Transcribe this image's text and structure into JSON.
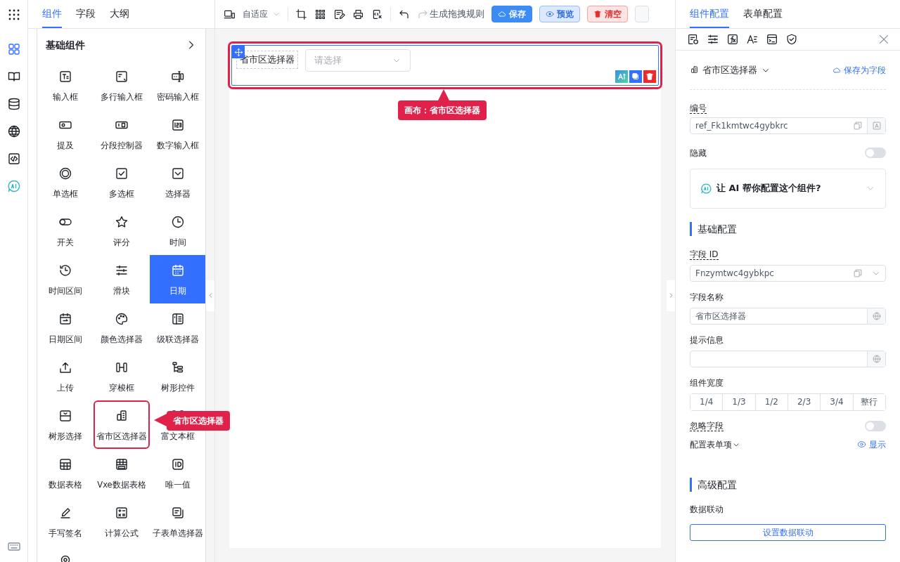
{
  "rail_items": [
    {
      "selected": true
    },
    {
      "selected": false
    },
    {
      "selected": false
    },
    {
      "selected": false
    },
    {
      "selected": false
    },
    {
      "selected": false
    }
  ],
  "left_tabs": [
    {
      "label": "组件",
      "selected": true
    },
    {
      "label": "字段",
      "selected": false
    },
    {
      "label": "大纲",
      "selected": false
    }
  ],
  "palette": {
    "title": "基础组件",
    "items": [
      {
        "label": "输入框",
        "selected": false,
        "annotated": false
      },
      {
        "label": "多行输入框",
        "selected": false,
        "annotated": false
      },
      {
        "label": "密码输入框",
        "selected": false,
        "annotated": false
      },
      {
        "label": "提及",
        "selected": false,
        "annotated": false
      },
      {
        "label": "分段控制器",
        "selected": false,
        "annotated": false
      },
      {
        "label": "数字输入框",
        "selected": false,
        "annotated": false
      },
      {
        "label": "单选框",
        "selected": false,
        "annotated": false
      },
      {
        "label": "多选框",
        "selected": false,
        "annotated": false
      },
      {
        "label": "选择器",
        "selected": false,
        "annotated": false
      },
      {
        "label": "开关",
        "selected": false,
        "annotated": false
      },
      {
        "label": "评分",
        "selected": false,
        "annotated": false
      },
      {
        "label": "时间",
        "selected": false,
        "annotated": false
      },
      {
        "label": "时间区间",
        "selected": false,
        "annotated": false
      },
      {
        "label": "滑块",
        "selected": false,
        "annotated": false
      },
      {
        "label": "日期",
        "selected": true,
        "annotated": false
      },
      {
        "label": "日期区间",
        "selected": false,
        "annotated": false
      },
      {
        "label": "颜色选择器",
        "selected": false,
        "annotated": false
      },
      {
        "label": "级联选择器",
        "selected": false,
        "annotated": false
      },
      {
        "label": "上传",
        "selected": false,
        "annotated": false
      },
      {
        "label": "穿梭框",
        "selected": false,
        "annotated": false
      },
      {
        "label": "树形控件",
        "selected": false,
        "annotated": false
      },
      {
        "label": "树形选择",
        "selected": false,
        "annotated": false
      },
      {
        "label": "省市区选择器",
        "selected": false,
        "annotated": true
      },
      {
        "label": "富文本框",
        "selected": false,
        "annotated": false
      },
      {
        "label": "数据表格",
        "selected": false,
        "annotated": false
      },
      {
        "label": "Vxe数据表格",
        "selected": false,
        "annotated": false
      },
      {
        "label": "唯一值",
        "selected": false,
        "annotated": false
      },
      {
        "label": "手写签名",
        "selected": false,
        "annotated": false
      },
      {
        "label": "计算公式",
        "selected": false,
        "annotated": false
      },
      {
        "label": "子表单选择器",
        "selected": false,
        "annotated": false
      },
      {
        "selected": false,
        "annotated": false
      }
    ]
  },
  "toolbar": {
    "layout_select": "自适应",
    "generate_rules": "生成拖拽规则",
    "buttons": [
      {
        "label": "保存",
        "kind": "primary"
      },
      {
        "label": "预览",
        "kind": "info"
      },
      {
        "label": "清空",
        "kind": "danger"
      }
    ]
  },
  "canvas": {
    "field": {
      "label": "省市区选择器",
      "placeholder": "请选择",
      "annotated": true
    }
  },
  "annotations": [
    {
      "text": "省市区选择器",
      "kind": "palette"
    },
    {
      "text": "画布：省市区选择器",
      "kind": "canvas"
    }
  ],
  "config": {
    "tabs": [
      {
        "label": "组件配置",
        "selected": true
      },
      {
        "label": "表单配置",
        "selected": false
      }
    ],
    "component": "省市区选择器",
    "save_as_field": "保存为字段",
    "ref_label": "编号",
    "ref_value": "ref_Fk1kmtwc4gybkrc",
    "hidden_label": "隐藏",
    "hidden": false,
    "ai_prompt": "让 AI 帮你配置这个组件?",
    "basic_title": "基础配置",
    "field_id_label": "字段 ID",
    "field_id_value": "Fnzymtwc4gybkpc",
    "field_name_label": "字段名称",
    "field_name_value": "省市区选择器",
    "hint_label": "提示信息",
    "width_label": "组件宽度",
    "widths": [
      {
        "label": "1/4",
        "selected": false
      },
      {
        "label": "1/3",
        "selected": false
      },
      {
        "label": "1/2",
        "selected": false
      },
      {
        "label": "2/3",
        "selected": false
      },
      {
        "label": "3/4",
        "selected": false
      },
      {
        "label": "整行",
        "selected": false
      }
    ],
    "ignore_label": "忽略字段",
    "ignore": false,
    "form_items_label": "配置表单项",
    "show_link": "显示",
    "advanced_title": "高级配置",
    "linkage_label": "数据联动",
    "linkage_button": "设置数据联动"
  }
}
